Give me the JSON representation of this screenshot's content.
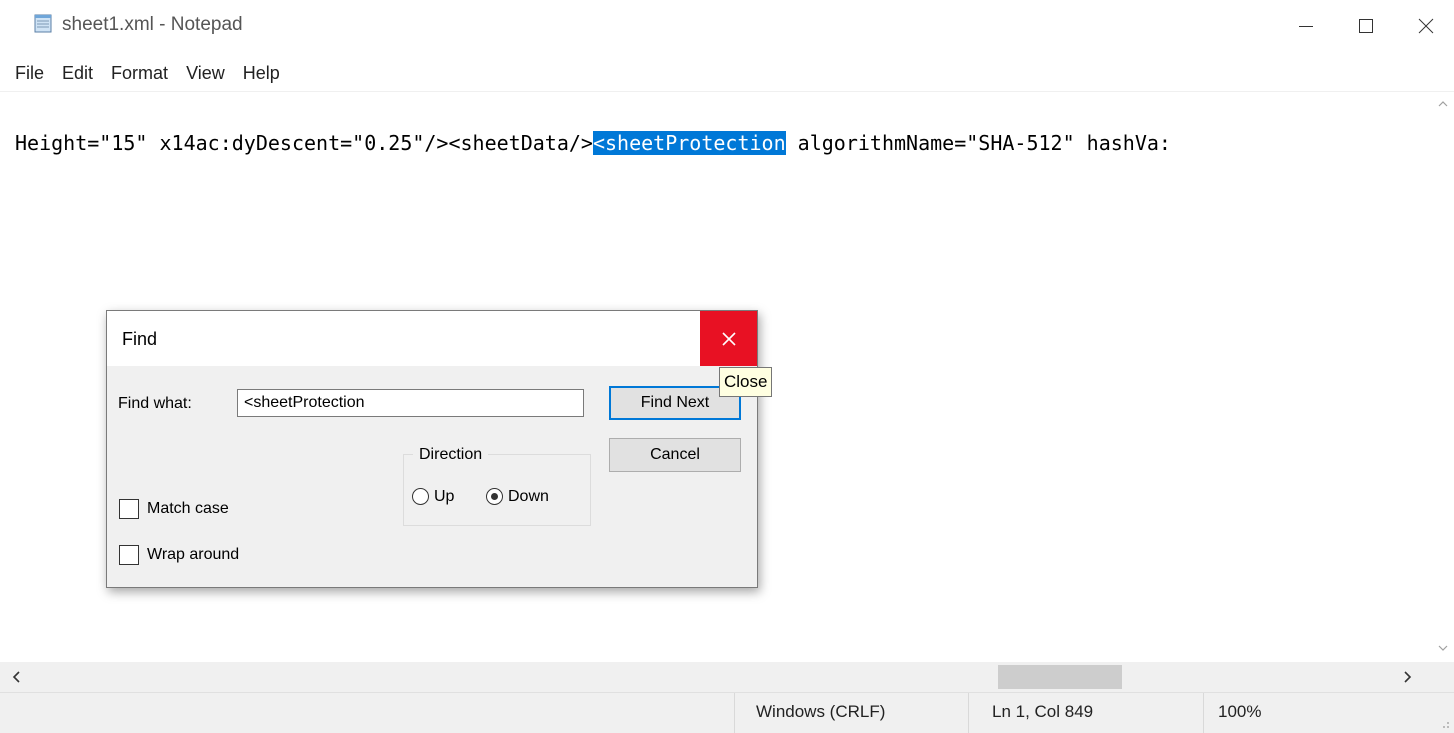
{
  "window": {
    "title": "sheet1.xml - Notepad"
  },
  "menu": [
    "File",
    "Edit",
    "Format",
    "View",
    "Help"
  ],
  "editor": {
    "text_before": "Height=\"15\" x14ac:dyDescent=\"0.25\"/><sheetData/>",
    "selected_text": "<sheetProtection",
    "text_after": " algorithmName=\"SHA-512\" hashVa:"
  },
  "status": {
    "line_ending": "Windows (CRLF)",
    "position": "Ln 1, Col 849",
    "zoom": "100%"
  },
  "find_dialog": {
    "title": "Find",
    "find_what_label": "Find what:",
    "find_what_value": "<sheetProtection",
    "find_next_label": "Find Next",
    "cancel_label": "Cancel",
    "direction_label": "Direction",
    "up_label": "Up",
    "down_label": "Down",
    "direction_selected": "Down",
    "match_case_label": "Match case",
    "match_case_checked": false,
    "wrap_around_label": "Wrap around",
    "wrap_around_checked": false,
    "close_tooltip": "Close"
  },
  "colors": {
    "selection": "#0078d7",
    "close_button": "#e81123",
    "tooltip_bg": "#ffffe1"
  }
}
